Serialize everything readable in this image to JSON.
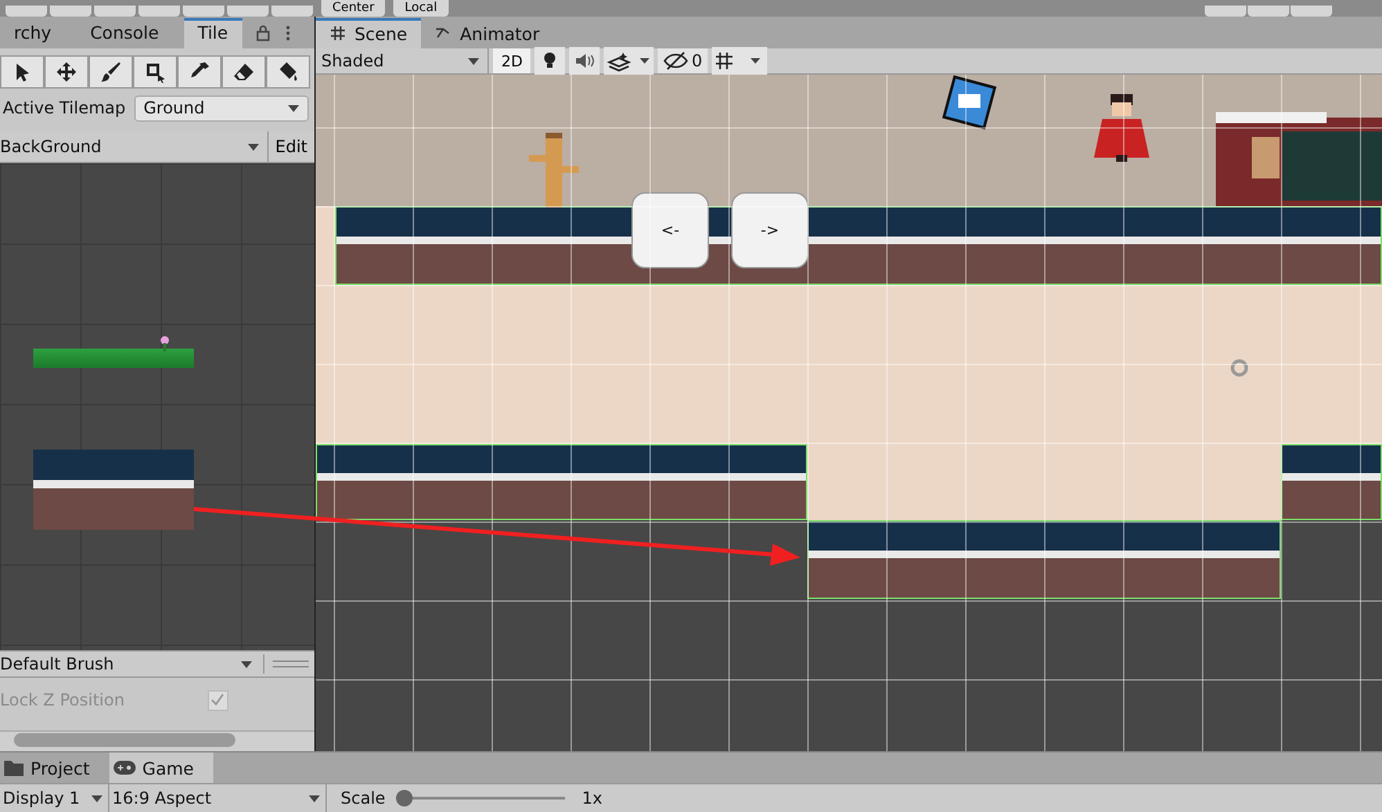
{
  "top_toolbar": {
    "pivot_buttons": [
      "Center",
      "Local"
    ]
  },
  "left_tabs": [
    {
      "label": "rchy",
      "selected": false
    },
    {
      "label": "Console",
      "selected": false
    },
    {
      "label": "Tile",
      "selected": true
    }
  ],
  "scene_tabs": [
    {
      "label": "Scene",
      "selected": true
    },
    {
      "label": "Animator",
      "selected": false
    }
  ],
  "scene_toolbar": {
    "shading": "Shaded",
    "mode_2d": {
      "label": "2D",
      "on": true
    },
    "hidden_count": "0"
  },
  "tile_palette": {
    "tools": [
      {
        "kind": "select"
      },
      {
        "kind": "move"
      },
      {
        "kind": "paint"
      },
      {
        "kind": "box"
      },
      {
        "kind": "picker"
      },
      {
        "kind": "erase"
      },
      {
        "kind": "fill"
      }
    ],
    "active_tilemap_label": "Active Tilemap",
    "active_tilemap": "Ground",
    "palette": "BackGround",
    "edit": "Edit",
    "brush": "Default Brush",
    "lock_z": {
      "label": "Lock Z Position",
      "checked": true
    }
  },
  "game_buttons": [
    "<-",
    "->"
  ],
  "bottom_tabs": [
    {
      "label": "Project",
      "selected": false
    },
    {
      "label": "Game",
      "selected": true
    }
  ],
  "game_bar": {
    "display": "Display 1",
    "aspect": "16:9 Aspect",
    "scale_label": "Scale",
    "scale": {
      "level": 0
    },
    "scale_value": "1x"
  }
}
